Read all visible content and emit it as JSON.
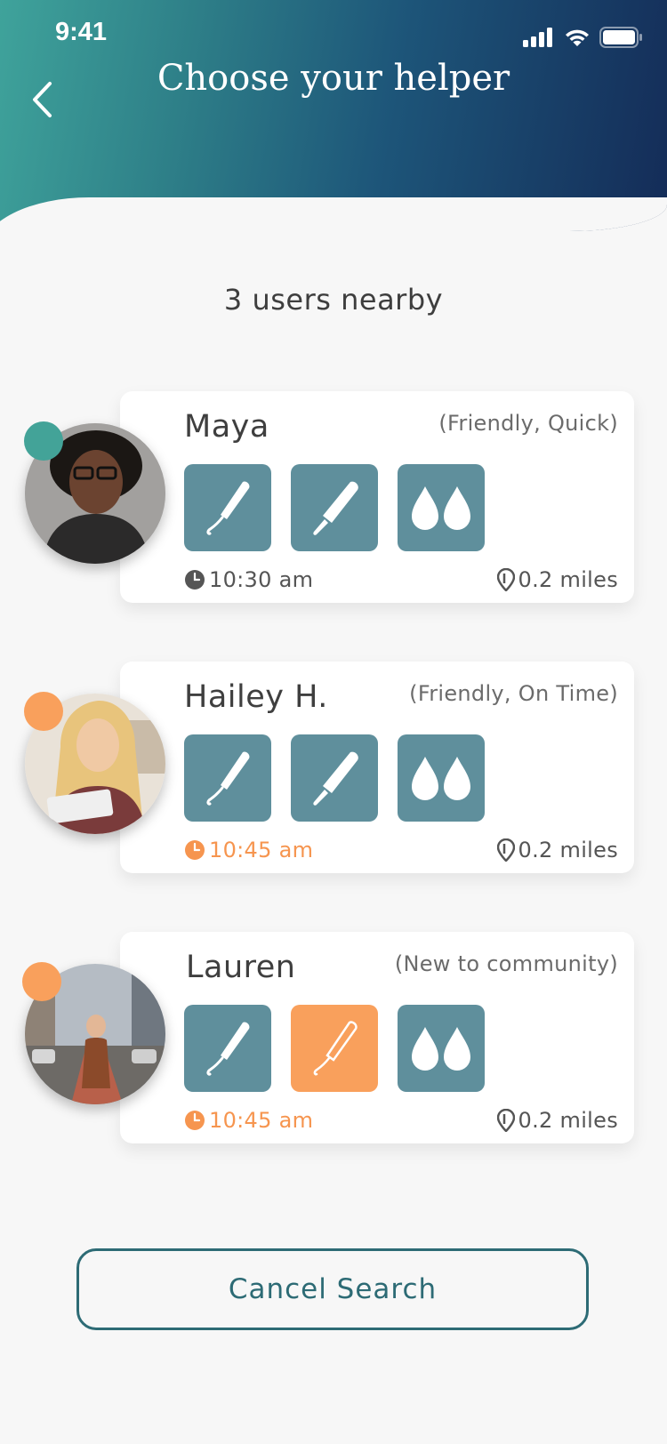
{
  "status_bar": {
    "time": "9:41"
  },
  "header": {
    "title": "Choose your helper"
  },
  "nearby_text": "3 users nearby",
  "helpers": [
    {
      "name": "Maya",
      "traits": "(Friendly, Quick)",
      "time": "10:30 am",
      "distance": "0.2 miles",
      "status_color": "#43a398",
      "time_color": "#555555",
      "products": [
        "tampon-applicator-icon",
        "tampon-icon",
        "drops-icon"
      ],
      "highlighted_product": null
    },
    {
      "name": "Hailey H.",
      "traits": "(Friendly, On Time)",
      "time": "10:45 am",
      "distance": "0.2 miles",
      "status_color": "#f9a05c",
      "time_color": "#f6954f",
      "products": [
        "tampon-applicator-icon",
        "tampon-icon",
        "drops-icon"
      ],
      "highlighted_product": null
    },
    {
      "name": "Lauren",
      "traits": "(New to community)",
      "time": "10:45 am",
      "distance": "0.2 miles",
      "status_color": "#f9a05c",
      "time_color": "#f6954f",
      "products": [
        "tampon-applicator-icon",
        "tampon-icon",
        "drops-icon"
      ],
      "highlighted_product": "tampon-icon"
    }
  ],
  "cancel_label": "Cancel Search",
  "colors": {
    "header_gradient_start": "#3fa39b",
    "header_gradient_end": "#142c58",
    "tile": "#5f8f9c",
    "accent_orange": "#f9a05c",
    "button_border": "#2d6b75"
  }
}
